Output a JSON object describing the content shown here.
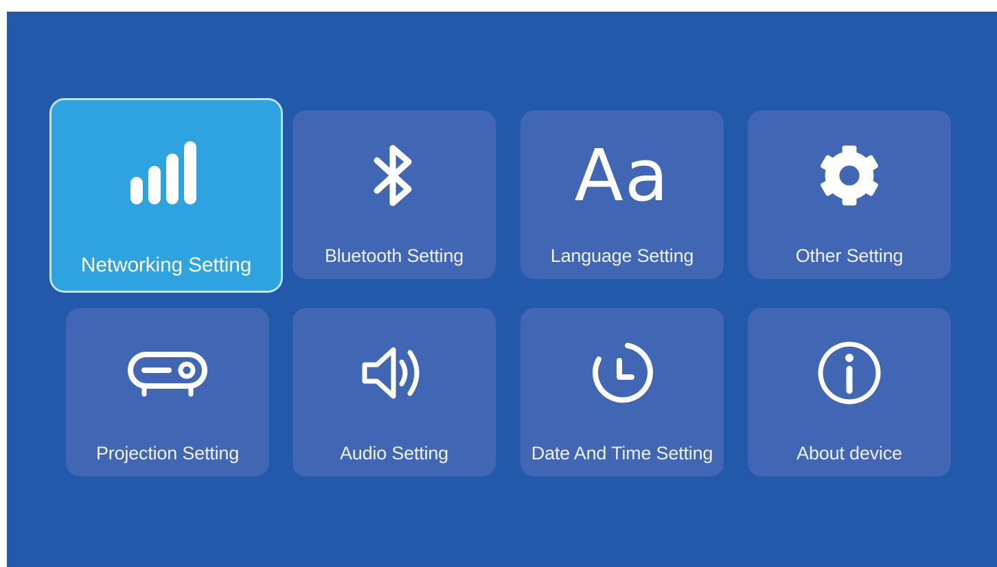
{
  "tiles": [
    {
      "id": "networking",
      "label": "Networking Setting",
      "icon": "signal-bars-icon",
      "selected": true
    },
    {
      "id": "bluetooth",
      "label": "Bluetooth Setting",
      "icon": "bluetooth-icon",
      "selected": false
    },
    {
      "id": "language",
      "label": "Language Setting",
      "icon": "language-aa-icon",
      "icon_text": "Aa",
      "selected": false
    },
    {
      "id": "other",
      "label": "Other Setting",
      "icon": "gear-icon",
      "selected": false
    },
    {
      "id": "projection",
      "label": "Projection Setting",
      "icon": "projector-icon",
      "selected": false
    },
    {
      "id": "audio",
      "label": "Audio Setting",
      "icon": "speaker-icon",
      "selected": false
    },
    {
      "id": "datetime",
      "label": "Date And Time Setting",
      "icon": "clock-icon",
      "selected": false
    },
    {
      "id": "about",
      "label": "About device",
      "icon": "info-icon",
      "selected": false
    }
  ],
  "colors": {
    "background": "#2259ab",
    "tile": "#4166b3",
    "selected_tile": "#2ea3df",
    "selected_border": "#b9e6fb",
    "icon": "#ffffff"
  }
}
